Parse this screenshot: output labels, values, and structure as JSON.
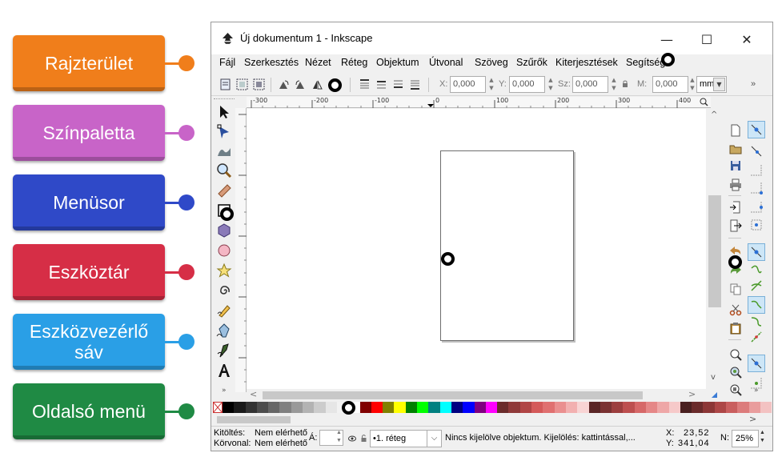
{
  "labels": [
    {
      "text": "Rajzterület",
      "color": "#f07e1b",
      "dot": "#f07e1b"
    },
    {
      "text": "Színpaletta",
      "color": "#c864c8",
      "dot": "#c864c8"
    },
    {
      "text": "Menüsor",
      "color": "#2f49c8",
      "dot": "#2f49c8"
    },
    {
      "text": "Eszköztár",
      "color": "#d62e46",
      "dot": "#d62e46"
    },
    {
      "text": "Eszközvezérlő sáv",
      "color": "#2a9fe6",
      "dot": "#2a9fe6"
    },
    {
      "text": "Oldalsó menü",
      "color": "#1f8a44",
      "dot": "#1f8a44"
    }
  ],
  "window": {
    "title": "Új dokumentum 1 - Inkscape",
    "minimize": "—",
    "maximize": "☐",
    "close": "✕"
  },
  "menu": {
    "items": [
      "Fájl",
      "Szerkesztés",
      "Nézet",
      "Réteg",
      "Objektum",
      "Útvonal",
      "Szöveg",
      "Szűrők",
      "Kiterjesztések",
      "Segítség"
    ]
  },
  "controls": {
    "x_label": "X:",
    "x_value": "0,000",
    "y_label": "Y:",
    "y_value": "0,000",
    "w_label": "Sz:",
    "w_value": "0,000",
    "h_label": "M:",
    "h_value": "0,000",
    "unit": "mm",
    "overflow": "»"
  },
  "ruler": {
    "labels": [
      "-300",
      "-200",
      "-100",
      "0",
      "100",
      "200",
      "300",
      "400"
    ]
  },
  "palette": {
    "colors": [
      "#000000",
      "#1a1a1a",
      "#333333",
      "#4d4d4d",
      "#666666",
      "#808080",
      "#999999",
      "#b3b3b3",
      "#cccccc",
      "#e6e6e6",
      "#f2f2f2",
      "#ffffff",
      "#800000",
      "#ff0000",
      "#808000",
      "#ffff00",
      "#008000",
      "#00ff00",
      "#008080",
      "#00ffff",
      "#000080",
      "#0000ff",
      "#800080",
      "#ff00ff",
      "#6b2c2c",
      "#8f3a3a",
      "#b04545",
      "#d45a5a",
      "#e07070",
      "#ea8f8f",
      "#f2b0b0",
      "#f8d4d4",
      "#5a2626",
      "#7a3232",
      "#9c3e3e",
      "#bd4f4f",
      "#d66868",
      "#e58787",
      "#eea7a7",
      "#f6c9c9",
      "#4a2020",
      "#6a2b2b",
      "#8c3737",
      "#ad4747",
      "#c95f5f",
      "#dc7c7c",
      "#e99d9d",
      "#f3c2c2"
    ]
  },
  "status": {
    "fill_label": "Kitöltés:",
    "fill_value": "Nem elérhető",
    "stroke_label": "Körvonal:",
    "stroke_value": "Nem elérhető",
    "opacity_label": "Á:",
    "layer": "•1. réteg",
    "message": "Nincs kijelölve objektum. Kijelölés: kattintással,...",
    "x_label": "X:",
    "x_value": "23,52",
    "y_label": "Y:",
    "y_value": "341,04",
    "zoom_label": "N:",
    "zoom_value": "25%"
  }
}
